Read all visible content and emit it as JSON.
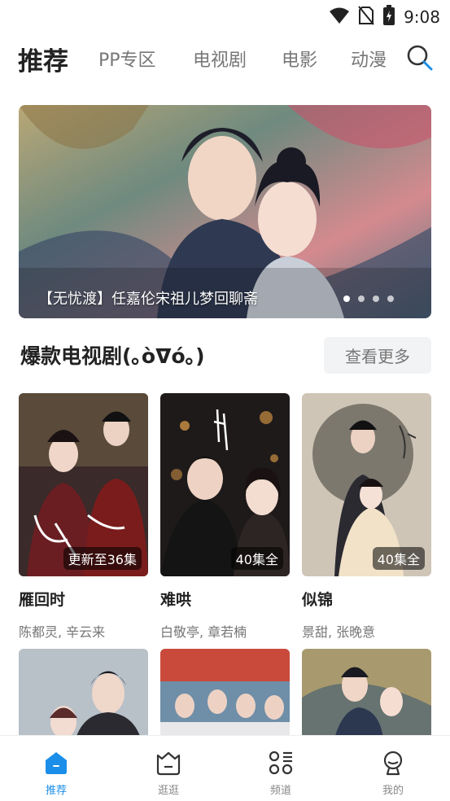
{
  "status_bar": {
    "time": "9:08",
    "icons": [
      "wifi-icon",
      "no-sim-icon",
      "battery-charging-icon"
    ]
  },
  "top_nav": {
    "tabs": [
      {
        "label": "推荐",
        "active": true
      },
      {
        "label": "PP专区"
      },
      {
        "label": "电视剧"
      },
      {
        "label": "电影"
      },
      {
        "label": "动漫"
      }
    ],
    "search_icon": "search-icon"
  },
  "banner": {
    "caption": "【无忧渡】任嘉伦宋祖儿梦回聊斋",
    "dot_count": 4,
    "active_dot": 1
  },
  "section": {
    "title": "爆款电视剧(｡òᐁó｡)",
    "more_label": "查看更多"
  },
  "cards": [
    {
      "title": "雁回时",
      "cast": "陈都灵, 辛云来",
      "badge": "更新至36集"
    },
    {
      "title": "难哄",
      "cast": "白敬亭, 章若楠",
      "badge": "40集全"
    },
    {
      "title": "似锦",
      "cast": "景甜, 张晚意",
      "badge": "40集全"
    }
  ],
  "bottom_nav": [
    {
      "label": "推荐",
      "icon": "home-icon",
      "active": true
    },
    {
      "label": "逛逛",
      "icon": "basket-icon"
    },
    {
      "label": "频道",
      "icon": "channel-grid-icon"
    },
    {
      "label": "我的",
      "icon": "profile-icon"
    }
  ],
  "colors": {
    "accent": "#1a8ee8",
    "text_primary": "#222222",
    "text_secondary": "#777777",
    "chip_bg": "#f2f3f5"
  }
}
